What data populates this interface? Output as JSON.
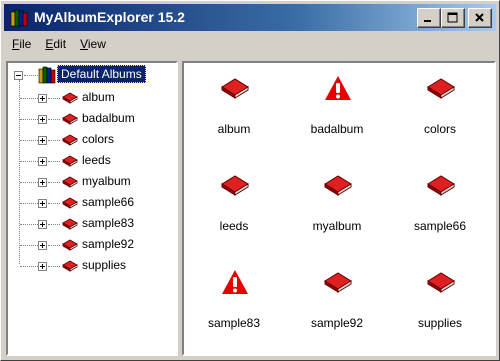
{
  "window": {
    "title": "MyAlbumExplorer 15.2"
  },
  "menu": [
    {
      "label": "File",
      "key": "F",
      "rest": "ile"
    },
    {
      "label": "Edit",
      "key": "E",
      "rest": "dit"
    },
    {
      "label": "View",
      "key": "V",
      "rest": "iew"
    }
  ],
  "tree": {
    "root": "Default Albums",
    "items": [
      "album",
      "badalbum",
      "colors",
      "leeds",
      "myalbum",
      "sample66",
      "sample83",
      "sample92",
      "supplies"
    ]
  },
  "list": {
    "items": [
      {
        "label": "album",
        "icon": "book-icon"
      },
      {
        "label": "badalbum",
        "icon": "warning-icon"
      },
      {
        "label": "colors",
        "icon": "book-icon"
      },
      {
        "label": "leeds",
        "icon": "book-icon"
      },
      {
        "label": "myalbum",
        "icon": "book-icon"
      },
      {
        "label": "sample66",
        "icon": "book-icon"
      },
      {
        "label": "sample83",
        "icon": "warning-icon"
      },
      {
        "label": "sample92",
        "icon": "book-icon"
      },
      {
        "label": "supplies",
        "icon": "book-icon"
      }
    ]
  },
  "colors": {
    "title_bar_start": "#0a246a",
    "book_red": "#cc0000",
    "warning_red": "#e60000"
  }
}
